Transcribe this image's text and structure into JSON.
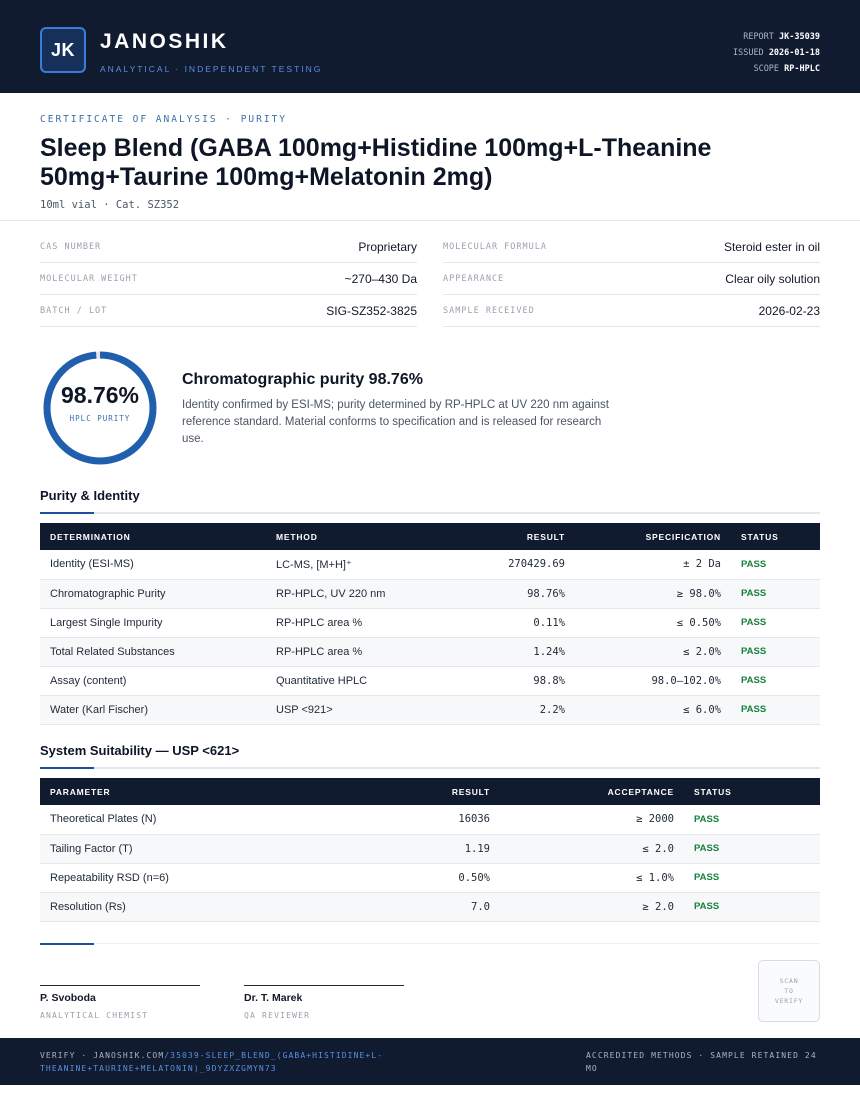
{
  "header": {
    "logo_initials": "JK",
    "brand": "JANOSHIK",
    "tagline": "ANALYTICAL · INDEPENDENT TESTING",
    "report_label": "REPORT",
    "report_value": "JK-35039",
    "issued_label": "ISSUED",
    "issued_value": "2026-01-18",
    "scope_label": "SCOPE",
    "scope_value": "RP-HPLC"
  },
  "certificate": {
    "kicker": "CERTIFICATE OF ANALYSIS · PURITY",
    "title": "Sleep Blend (GABA 100mg+Histidine 100mg+L-Theanine 50mg+Taurine 100mg+Melatonin 2mg)",
    "subtitle": "10ml vial · Cat. SZ352"
  },
  "info": {
    "cas_label": "CAS NUMBER",
    "cas_value": "Proprietary",
    "formula_label": "MOLECULAR FORMULA",
    "formula_value": "Steroid ester in oil",
    "weight_label": "MOLECULAR WEIGHT",
    "weight_value": "~270–430 Da",
    "appearance_label": "APPEARANCE",
    "appearance_value": "Clear oily solution",
    "batch_label": "BATCH / LOT",
    "batch_value": "SIG-SZ352-3825",
    "received_label": "SAMPLE RECEIVED",
    "received_value": "2026-02-23"
  },
  "purity": {
    "value_text": "98.76%",
    "fraction": 0.9876,
    "gauge_label": "HPLC PURITY",
    "heading": "Chromatographic purity 98.76%",
    "description": "Identity confirmed by ESI-MS; purity determined by RP-HPLC at UV 220 nm against reference standard. Material conforms to specification and is released for research use."
  },
  "purity_section": {
    "title": "Purity & Identity",
    "columns": [
      "DETERMINATION",
      "METHOD",
      "RESULT",
      "SPECIFICATION",
      "STATUS"
    ],
    "rows": [
      {
        "determination": "Identity (ESI-MS)",
        "method": "LC-MS, [M+H]⁺",
        "result": "270429.69",
        "spec": "± 2 Da",
        "status": "PASS"
      },
      {
        "determination": "Chromatographic Purity",
        "method": "RP-HPLC, UV 220 nm",
        "result": "98.76%",
        "spec": "≥ 98.0%",
        "status": "PASS"
      },
      {
        "determination": "Largest Single Impurity",
        "method": "RP-HPLC area %",
        "result": "0.11%",
        "spec": "≤ 0.50%",
        "status": "PASS"
      },
      {
        "determination": "Total Related Substances",
        "method": "RP-HPLC area %",
        "result": "1.24%",
        "spec": "≤ 2.0%",
        "status": "PASS"
      },
      {
        "determination": "Assay (content)",
        "method": "Quantitative HPLC",
        "result": "98.8%",
        "spec": "98.0–102.0%",
        "status": "PASS"
      },
      {
        "determination": "Water (Karl Fischer)",
        "method": "USP <921>",
        "result": "2.2%",
        "spec": "≤ 6.0%",
        "status": "PASS"
      }
    ]
  },
  "suitability_section": {
    "title": "System Suitability — USP <621>",
    "columns": [
      "PARAMETER",
      "RESULT",
      "ACCEPTANCE",
      "STATUS"
    ],
    "rows": [
      {
        "parameter": "Theoretical Plates (N)",
        "result": "16036",
        "acceptance": "≥ 2000",
        "status": "PASS"
      },
      {
        "parameter": "Tailing Factor (T)",
        "result": "1.19",
        "acceptance": "≤ 2.0",
        "status": "PASS"
      },
      {
        "parameter": "Repeatability RSD (n=6)",
        "result": "0.50%",
        "acceptance": "≤ 1.0%",
        "status": "PASS"
      },
      {
        "parameter": "Resolution (Rs)",
        "result": "7.0",
        "acceptance": "≥ 2.0",
        "status": "PASS"
      }
    ]
  },
  "signatures": {
    "sig1_name": "P. Svoboda",
    "sig1_role": "ANALYTICAL CHEMIST",
    "sig2_name": "Dr. T. Marek",
    "sig2_role": "QA REVIEWER",
    "qr_line1": "SCAN",
    "qr_line2": "TO",
    "qr_line3": "VERIFY"
  },
  "footer": {
    "verify_prefix": "VERIFY · JANOSHIK.COM",
    "verify_path": "/35039-SLEEP_BLEND_(GABA+HISTIDINE+L-THEANINE+TAURINE+MELATONIN)_9DYZXZGMYN73",
    "right_text": "ACCREDITED METHODS · SAMPLE RETAINED 24 MO"
  },
  "colors": {
    "navy": "#101b30",
    "accent_blue": "#1f5fae",
    "pass_green": "#16803c"
  }
}
